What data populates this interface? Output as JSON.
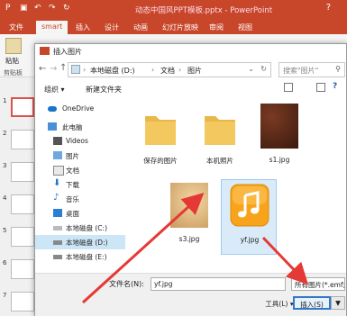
{
  "titlebar": {
    "title": "动态中国风PPT模板.pptx - PowerPoint",
    "help": "?"
  },
  "ribbon_tabs": [
    "文件",
    "smart",
    "插入",
    "设计",
    "动画",
    "幻灯片放映",
    "审阅",
    "视图"
  ],
  "ribbon_left": {
    "paste_label": "粘贴",
    "clipboard_label": "剪贴板"
  },
  "slides": {
    "numbers": [
      "1",
      "2",
      "3",
      "4",
      "5",
      "6",
      "7"
    ]
  },
  "dialog": {
    "title": "插入图片",
    "address": {
      "path": [
        "本地磁盘 (D:)",
        "文档",
        "图片"
      ],
      "sep": "›"
    },
    "search_placeholder": "搜索\"图片\"",
    "toolbar": {
      "organize": "组织 ▾",
      "new_folder": "新建文件夹"
    },
    "nav": [
      "OneDrive",
      "此电脑",
      "Videos",
      "图片",
      "文档",
      "下载",
      "音乐",
      "桌面",
      "本地磁盘 (C:)",
      "本地磁盘 (D:)",
      "本地磁盘 (E:)"
    ],
    "files": [
      {
        "name": "保存的图片",
        "kind": "folder"
      },
      {
        "name": "本机照片",
        "kind": "folder"
      },
      {
        "name": "s1.jpg",
        "kind": "image"
      },
      {
        "name": "s3.jpg",
        "kind": "image"
      },
      {
        "name": "yf.jpg",
        "kind": "image"
      }
    ],
    "filename_label": "文件名(N):",
    "filename_value": "yf.jpg",
    "filetype_value": "所有图片(*.emf;*",
    "tools_label": "工具(L)",
    "insert_label": "插入(S)",
    "dropdown_arrow": "▼"
  },
  "icons": {
    "back": "back-arrow-icon",
    "forward": "forward-arrow-icon",
    "up": "up-arrow-icon",
    "refresh": "refresh-icon",
    "search": "search-icon",
    "music": "music-note-icon"
  },
  "colors": {
    "accent": "#c8462a",
    "arrow": "#e53935",
    "selection": "#cde6f7",
    "folder": "#f3c85e",
    "music_tile": "#f5a623"
  }
}
